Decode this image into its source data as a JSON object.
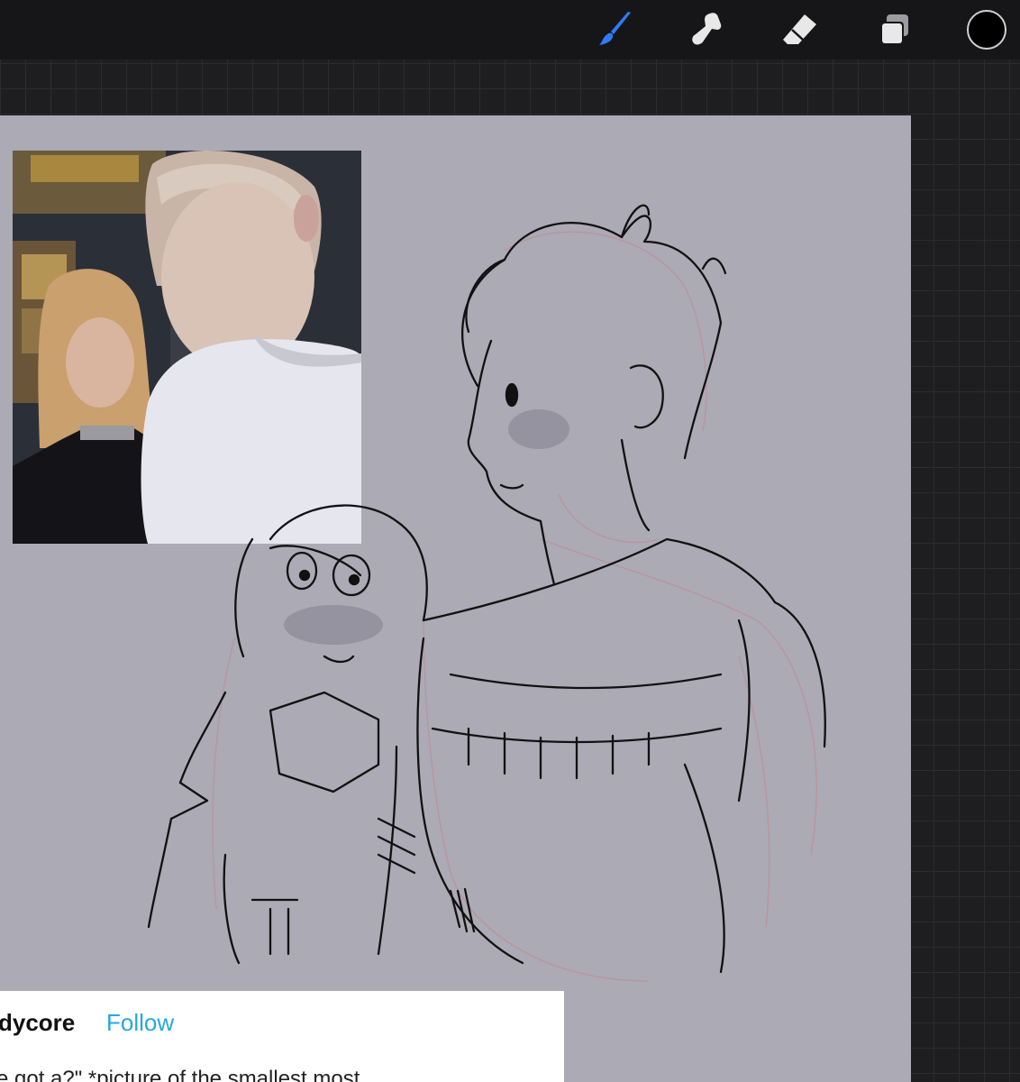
{
  "toolbar": {
    "tools": [
      {
        "name": "brush",
        "icon": "brush-icon",
        "active": true
      },
      {
        "name": "smudge",
        "icon": "smudge-icon",
        "active": false
      },
      {
        "name": "eraser",
        "icon": "eraser-icon",
        "active": false
      },
      {
        "name": "layers",
        "icon": "layers-icon",
        "active": false
      }
    ],
    "current_color": "#000000",
    "accent_color": "#2f7bf5"
  },
  "canvas": {
    "background_color": "#abaab5"
  },
  "tumblr_card": {
    "blog_name": "dycore",
    "follow_label": "Follow",
    "post_text": "e got a?\" *picture of the smallest most"
  }
}
